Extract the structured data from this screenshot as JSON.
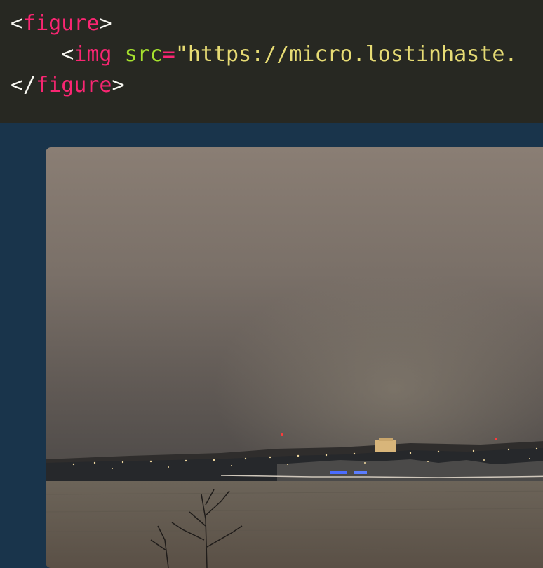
{
  "code": {
    "lines": [
      [
        {
          "t": "<",
          "c": "punct"
        },
        {
          "t": "figure",
          "c": "tag"
        },
        {
          "t": ">",
          "c": "punct"
        }
      ],
      [
        {
          "t": "    <",
          "c": "punct"
        },
        {
          "t": "img",
          "c": "tag"
        },
        {
          "t": " ",
          "c": "punct"
        },
        {
          "t": "src",
          "c": "attr"
        },
        {
          "t": "=",
          "c": "eq"
        },
        {
          "t": "\"https://micro.lostinhaste.",
          "c": "str"
        }
      ],
      [
        {
          "t": "</",
          "c": "punct"
        },
        {
          "t": "figure",
          "c": "tag"
        },
        {
          "t": ">",
          "c": "punct"
        }
      ]
    ]
  },
  "colors": {
    "code_background": "#272822",
    "page_background": "#19344b",
    "token_tag": "#f92672",
    "token_attr": "#a6e22e",
    "token_string": "#e6db74",
    "token_punct": "#f8f8f2"
  },
  "preview": {
    "image_subject": "night-sky-over-snowy-riverbank-city-lights"
  }
}
